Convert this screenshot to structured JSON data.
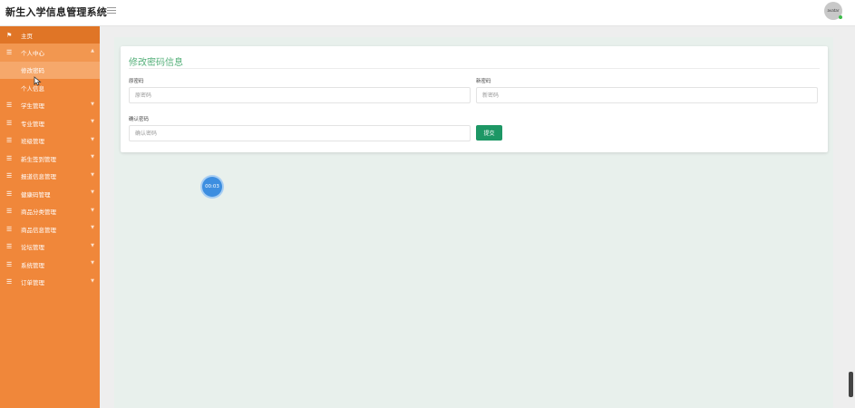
{
  "app": {
    "title": "新生入学信息管理系统",
    "avatar_text": "avatar"
  },
  "sidebar": {
    "home": "主页",
    "personal_center": "个人中心",
    "sub_items": [
      "修改密码",
      "个人信息"
    ],
    "items": [
      "学生管理",
      "专业管理",
      "班级管理",
      "新生签到管理",
      "报道信息管理",
      "健康码管理",
      "商品分类管理",
      "商品信息管理",
      "论坛管理",
      "系统管理",
      "订单管理"
    ]
  },
  "form": {
    "title": "修改密码信息",
    "old_password_label": "原密码",
    "old_password_placeholder": "原密码",
    "new_password_label": "新密码",
    "new_password_placeholder": "新密码",
    "confirm_password_label": "确认密码",
    "confirm_password_placeholder": "确认密码",
    "submit_label": "提交"
  },
  "timer": {
    "text": "00:03"
  },
  "colors": {
    "sidebar": "#f0873a",
    "accent_green": "#1d9765",
    "title_green": "#55b07a",
    "timer_blue": "#3d8ee0"
  }
}
